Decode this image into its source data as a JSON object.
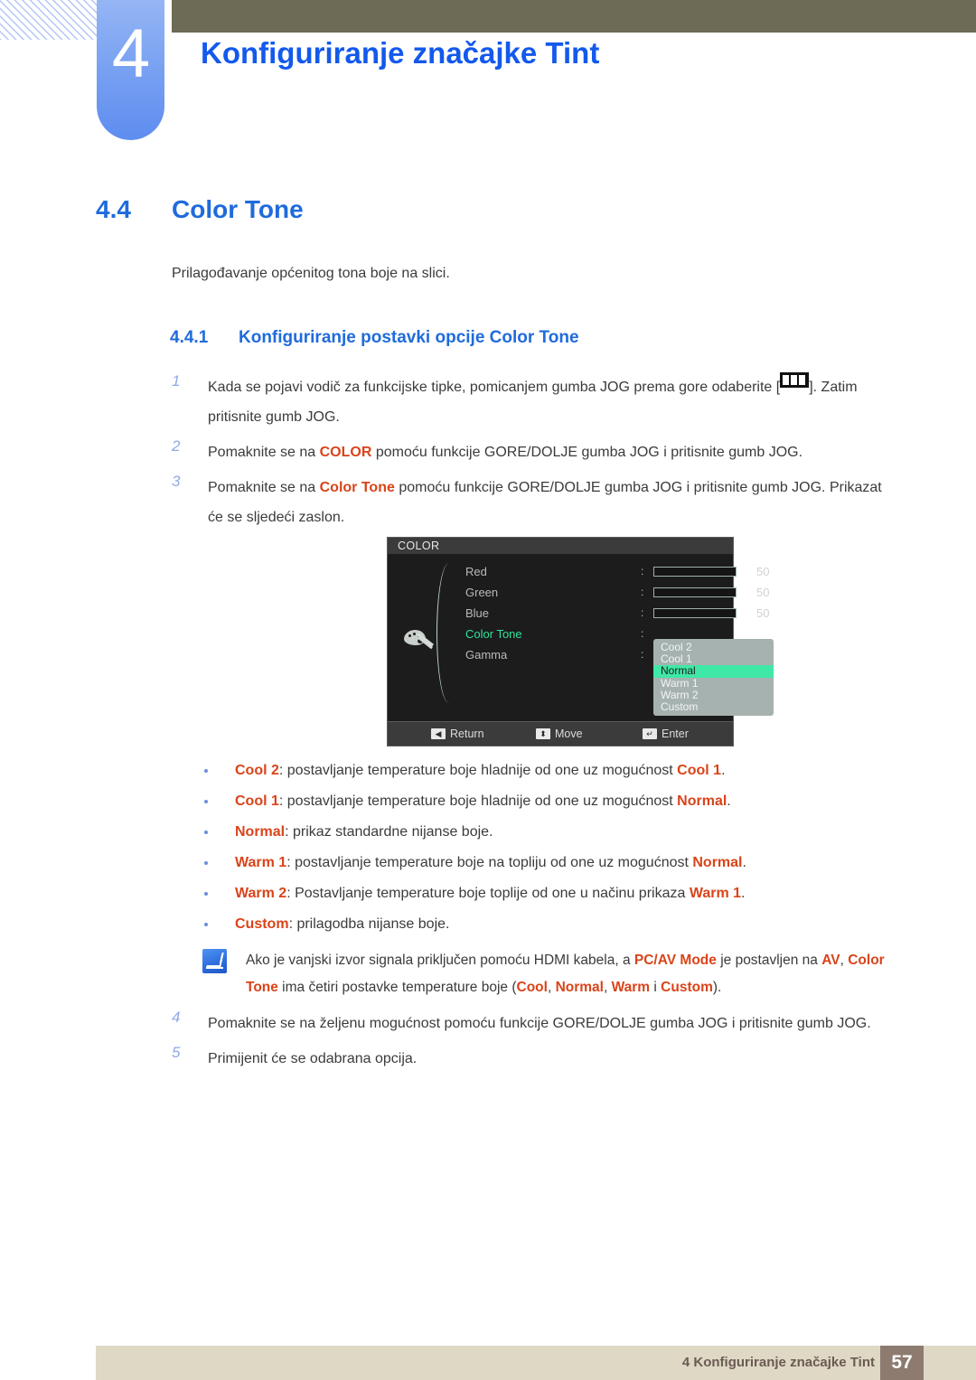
{
  "header": {
    "chapter_number": "4",
    "chapter_title": "Konfiguriranje značajke Tint"
  },
  "section": {
    "number": "4.4",
    "title": "Color Tone",
    "intro": "Prilagođavanje općenitog tona boje na slici.",
    "sub_number": "4.4.1",
    "sub_title": "Konfiguriranje postavki opcije Color Tone"
  },
  "steps": [
    {
      "marker": "1",
      "text_before": "Kada se pojavi vodič za funkcijske tipke, pomicanjem gumba JOG prema gore odaberite [",
      "icon": "jog-menu-icon",
      "text_after": "]. Zatim pritisnite gumb JOG."
    },
    {
      "marker": "2",
      "part1": "Pomaknite se na ",
      "highlight": "COLOR",
      "part2": " pomoću funkcije GORE/DOLJE gumba JOG i pritisnite gumb JOG."
    },
    {
      "marker": "3",
      "part1": "Pomaknite se na ",
      "highlight": "Color Tone",
      "part2": " pomoću funkcije GORE/DOLJE gumba JOG i pritisnite gumb JOG. Prikazat će se sljedeći zaslon."
    }
  ],
  "steps_late": [
    {
      "marker": "4",
      "text": "Pomaknite se na željenu mogućnost pomoću funkcije GORE/DOLJE gumba JOG i pritisnite gumb JOG."
    },
    {
      "marker": "5",
      "text": "Primijenit će se odabrana opcija."
    }
  ],
  "osd": {
    "title": "COLOR",
    "icon": "palette-icon",
    "rows": [
      {
        "label": "Red",
        "colon": ":",
        "value": "50",
        "fill_pct": 50
      },
      {
        "label": "Green",
        "colon": ":",
        "value": "50",
        "fill_pct": 50
      },
      {
        "label": "Blue",
        "colon": ":",
        "value": "50",
        "fill_pct": 50
      },
      {
        "label": "Color Tone",
        "colon": ":",
        "selected": true
      },
      {
        "label": "Gamma",
        "colon": ":"
      }
    ],
    "dropdown": {
      "options": [
        "Cool 2",
        "Cool 1",
        "Normal",
        "Warm 1",
        "Warm 2",
        "Custom"
      ],
      "active": "Normal"
    },
    "footer": [
      {
        "key": "◀",
        "label": "Return"
      },
      {
        "key": "⬍",
        "label": "Move"
      },
      {
        "key": "↵",
        "label": "Enter"
      }
    ],
    "colors": {
      "background": "#1c1c1c",
      "titlebar": "#3b3b3b",
      "highlight_green": "#3fe8a6",
      "selected_label": "#2fe39a",
      "dropdown_bg": "#a6b2b0"
    }
  },
  "bullets": [
    {
      "term": "Cool 2",
      "mid": ": postavljanje temperature boje hladnije od one uz mogućnost ",
      "term2": "Cool 1",
      "end": "."
    },
    {
      "term": "Cool 1",
      "mid": ": postavljanje temperature boje hladnije od one uz mogućnost ",
      "term2": "Normal",
      "end": "."
    },
    {
      "term": "Normal",
      "mid": ": prikaz standardne nijanse boje.",
      "term2": "",
      "end": ""
    },
    {
      "term": "Warm 1",
      "mid": ": postavljanje temperature boje na topliju od one uz mogućnost ",
      "term2": "Normal",
      "end": "."
    },
    {
      "term": "Warm 2",
      "mid": ": Postavljanje temperature boje toplije od one u načinu prikaza ",
      "term2": "Warm 1",
      "end": "."
    },
    {
      "term": "Custom",
      "mid": ": prilagodba nijanse boje.",
      "term2": "",
      "end": ""
    }
  ],
  "note": {
    "icon": "note-pen-icon",
    "l1_a": "Ako je vanjski izvor signala priključen pomoću HDMI kabela, a ",
    "l1_b": "PC/AV Mode",
    "l1_c": " je postavljen na ",
    "l2_a": "AV",
    "l2_b": ", ",
    "l2_c": "Color Tone",
    "l2_d": " ima četiri postavke temperature boje (",
    "l2_e": "Cool",
    "l2_f": ", ",
    "l2_g": "Normal",
    "l2_h": ", ",
    "l2_i": "Warm",
    "l2_j": " i ",
    "l2_k": "Custom",
    "l2_l": ")."
  },
  "footer": {
    "text": "4 Konfiguriranje značajke Tint",
    "page": "57"
  },
  "colors": {
    "heading_blue": "#1f6bdc",
    "title_blue": "#1359ec",
    "accent_orange": "#d9441a",
    "olive": "#6d6a56",
    "tab_blue": "#7ba3f2",
    "footer_beige": "#ded8c5",
    "footer_page_bg": "#8d7b70"
  }
}
